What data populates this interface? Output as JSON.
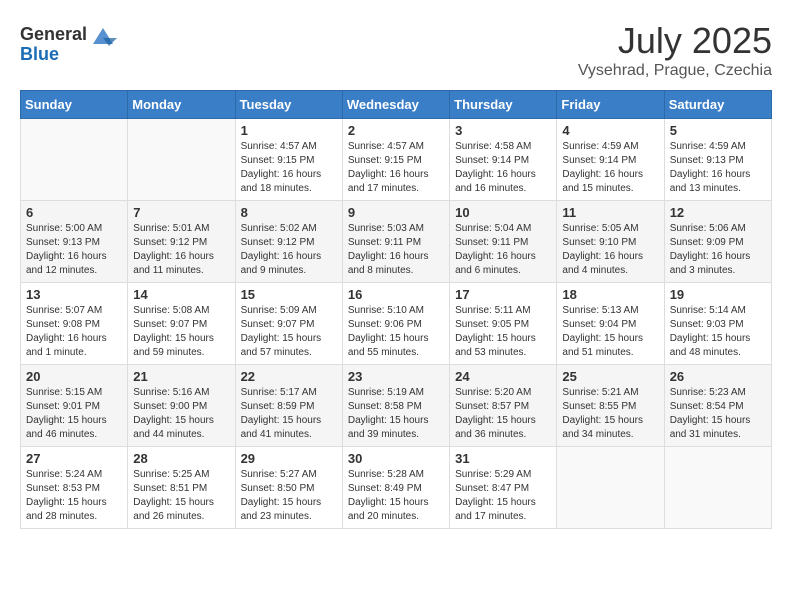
{
  "header": {
    "logo_general": "General",
    "logo_blue": "Blue",
    "month": "July 2025",
    "location": "Vysehrad, Prague, Czechia"
  },
  "days_of_week": [
    "Sunday",
    "Monday",
    "Tuesday",
    "Wednesday",
    "Thursday",
    "Friday",
    "Saturday"
  ],
  "weeks": [
    [
      {
        "day": "",
        "info": ""
      },
      {
        "day": "",
        "info": ""
      },
      {
        "day": "1",
        "info": "Sunrise: 4:57 AM\nSunset: 9:15 PM\nDaylight: 16 hours\nand 18 minutes."
      },
      {
        "day": "2",
        "info": "Sunrise: 4:57 AM\nSunset: 9:15 PM\nDaylight: 16 hours\nand 17 minutes."
      },
      {
        "day": "3",
        "info": "Sunrise: 4:58 AM\nSunset: 9:14 PM\nDaylight: 16 hours\nand 16 minutes."
      },
      {
        "day": "4",
        "info": "Sunrise: 4:59 AM\nSunset: 9:14 PM\nDaylight: 16 hours\nand 15 minutes."
      },
      {
        "day": "5",
        "info": "Sunrise: 4:59 AM\nSunset: 9:13 PM\nDaylight: 16 hours\nand 13 minutes."
      }
    ],
    [
      {
        "day": "6",
        "info": "Sunrise: 5:00 AM\nSunset: 9:13 PM\nDaylight: 16 hours\nand 12 minutes."
      },
      {
        "day": "7",
        "info": "Sunrise: 5:01 AM\nSunset: 9:12 PM\nDaylight: 16 hours\nand 11 minutes."
      },
      {
        "day": "8",
        "info": "Sunrise: 5:02 AM\nSunset: 9:12 PM\nDaylight: 16 hours\nand 9 minutes."
      },
      {
        "day": "9",
        "info": "Sunrise: 5:03 AM\nSunset: 9:11 PM\nDaylight: 16 hours\nand 8 minutes."
      },
      {
        "day": "10",
        "info": "Sunrise: 5:04 AM\nSunset: 9:11 PM\nDaylight: 16 hours\nand 6 minutes."
      },
      {
        "day": "11",
        "info": "Sunrise: 5:05 AM\nSunset: 9:10 PM\nDaylight: 16 hours\nand 4 minutes."
      },
      {
        "day": "12",
        "info": "Sunrise: 5:06 AM\nSunset: 9:09 PM\nDaylight: 16 hours\nand 3 minutes."
      }
    ],
    [
      {
        "day": "13",
        "info": "Sunrise: 5:07 AM\nSunset: 9:08 PM\nDaylight: 16 hours\nand 1 minute."
      },
      {
        "day": "14",
        "info": "Sunrise: 5:08 AM\nSunset: 9:07 PM\nDaylight: 15 hours\nand 59 minutes."
      },
      {
        "day": "15",
        "info": "Sunrise: 5:09 AM\nSunset: 9:07 PM\nDaylight: 15 hours\nand 57 minutes."
      },
      {
        "day": "16",
        "info": "Sunrise: 5:10 AM\nSunset: 9:06 PM\nDaylight: 15 hours\nand 55 minutes."
      },
      {
        "day": "17",
        "info": "Sunrise: 5:11 AM\nSunset: 9:05 PM\nDaylight: 15 hours\nand 53 minutes."
      },
      {
        "day": "18",
        "info": "Sunrise: 5:13 AM\nSunset: 9:04 PM\nDaylight: 15 hours\nand 51 minutes."
      },
      {
        "day": "19",
        "info": "Sunrise: 5:14 AM\nSunset: 9:03 PM\nDaylight: 15 hours\nand 48 minutes."
      }
    ],
    [
      {
        "day": "20",
        "info": "Sunrise: 5:15 AM\nSunset: 9:01 PM\nDaylight: 15 hours\nand 46 minutes."
      },
      {
        "day": "21",
        "info": "Sunrise: 5:16 AM\nSunset: 9:00 PM\nDaylight: 15 hours\nand 44 minutes."
      },
      {
        "day": "22",
        "info": "Sunrise: 5:17 AM\nSunset: 8:59 PM\nDaylight: 15 hours\nand 41 minutes."
      },
      {
        "day": "23",
        "info": "Sunrise: 5:19 AM\nSunset: 8:58 PM\nDaylight: 15 hours\nand 39 minutes."
      },
      {
        "day": "24",
        "info": "Sunrise: 5:20 AM\nSunset: 8:57 PM\nDaylight: 15 hours\nand 36 minutes."
      },
      {
        "day": "25",
        "info": "Sunrise: 5:21 AM\nSunset: 8:55 PM\nDaylight: 15 hours\nand 34 minutes."
      },
      {
        "day": "26",
        "info": "Sunrise: 5:23 AM\nSunset: 8:54 PM\nDaylight: 15 hours\nand 31 minutes."
      }
    ],
    [
      {
        "day": "27",
        "info": "Sunrise: 5:24 AM\nSunset: 8:53 PM\nDaylight: 15 hours\nand 28 minutes."
      },
      {
        "day": "28",
        "info": "Sunrise: 5:25 AM\nSunset: 8:51 PM\nDaylight: 15 hours\nand 26 minutes."
      },
      {
        "day": "29",
        "info": "Sunrise: 5:27 AM\nSunset: 8:50 PM\nDaylight: 15 hours\nand 23 minutes."
      },
      {
        "day": "30",
        "info": "Sunrise: 5:28 AM\nSunset: 8:49 PM\nDaylight: 15 hours\nand 20 minutes."
      },
      {
        "day": "31",
        "info": "Sunrise: 5:29 AM\nSunset: 8:47 PM\nDaylight: 15 hours\nand 17 minutes."
      },
      {
        "day": "",
        "info": ""
      },
      {
        "day": "",
        "info": ""
      }
    ]
  ]
}
